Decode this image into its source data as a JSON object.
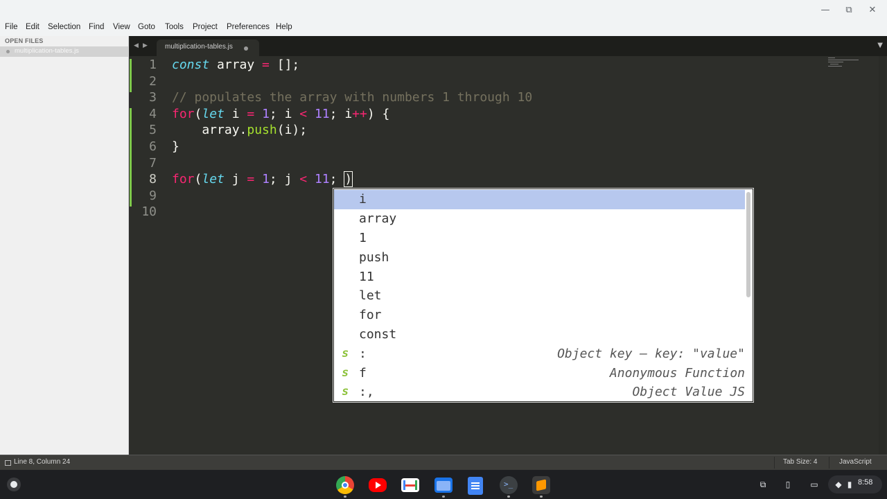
{
  "window": {
    "minimize_icon": "minimize-icon",
    "maximize_icon": "maximize-icon",
    "close_icon": "close-icon",
    "minimize_glyph": "—",
    "maximize_glyph": "⧉",
    "close_glyph": "✕"
  },
  "menu": {
    "items": [
      "File",
      "Edit",
      "Selection",
      "Find",
      "View",
      "Goto",
      "Tools",
      "Project",
      "Preferences",
      "Help"
    ]
  },
  "sidebar": {
    "header": "OPEN FILES",
    "file": "multiplication-tables.js"
  },
  "tabs": {
    "prev_glyph": "◀",
    "next_glyph": "▶",
    "active": "multiplication-tables.js",
    "dropdown_glyph": "▼"
  },
  "editor": {
    "line_numbers": [
      "1",
      "2",
      "3",
      "4",
      "5",
      "6",
      "7",
      "8",
      "9",
      "10"
    ],
    "lines": [
      "const array = [];",
      "",
      "// populates the array with numbers 1 through 10",
      "for(let i = 1; i < 11; i++) {",
      "    array.push(i);",
      "}",
      "",
      "for(let j = 1; j < 11; )",
      "",
      ""
    ]
  },
  "autocomplete": {
    "items": [
      {
        "kind": "",
        "label": "i",
        "hint": "",
        "selected": true
      },
      {
        "kind": "",
        "label": "array",
        "hint": ""
      },
      {
        "kind": "",
        "label": "1",
        "hint": ""
      },
      {
        "kind": "",
        "label": "push",
        "hint": ""
      },
      {
        "kind": "",
        "label": "11",
        "hint": ""
      },
      {
        "kind": "",
        "label": "let",
        "hint": ""
      },
      {
        "kind": "",
        "label": "for",
        "hint": ""
      },
      {
        "kind": "",
        "label": "const",
        "hint": ""
      },
      {
        "kind": "s",
        "label": ":",
        "hint": "Object key — key: \"value\""
      },
      {
        "kind": "s",
        "label": "f",
        "hint": "Anonymous Function"
      },
      {
        "kind": "s",
        "label": ":,",
        "hint": "Object Value JS"
      }
    ]
  },
  "status": {
    "position": "Line 8, Column 24",
    "tab_size": "Tab Size: 4",
    "syntax": "JavaScript"
  },
  "shelf": {
    "apps": [
      {
        "name": "chrome-icon",
        "color": "#4285f4"
      },
      {
        "name": "youtube-icon",
        "color": "#ff0000"
      },
      {
        "name": "gmail-icon",
        "color": "#ffffff"
      },
      {
        "name": "files-icon",
        "color": "#1a73e8"
      },
      {
        "name": "docs-icon",
        "color": "#4285f4"
      },
      {
        "name": "terminal-icon",
        "color": "#3c4043"
      },
      {
        "name": "sublime-icon",
        "color": "#ff9800"
      }
    ],
    "time": "8:58"
  },
  "colors": {
    "editor_bg": "#2d2e2a",
    "keyword": "#f92672",
    "storage": "#66d9ef",
    "number": "#ae81ff",
    "comment": "#75715e",
    "function": "#a6e22e",
    "selection": "#b7c8ee"
  }
}
